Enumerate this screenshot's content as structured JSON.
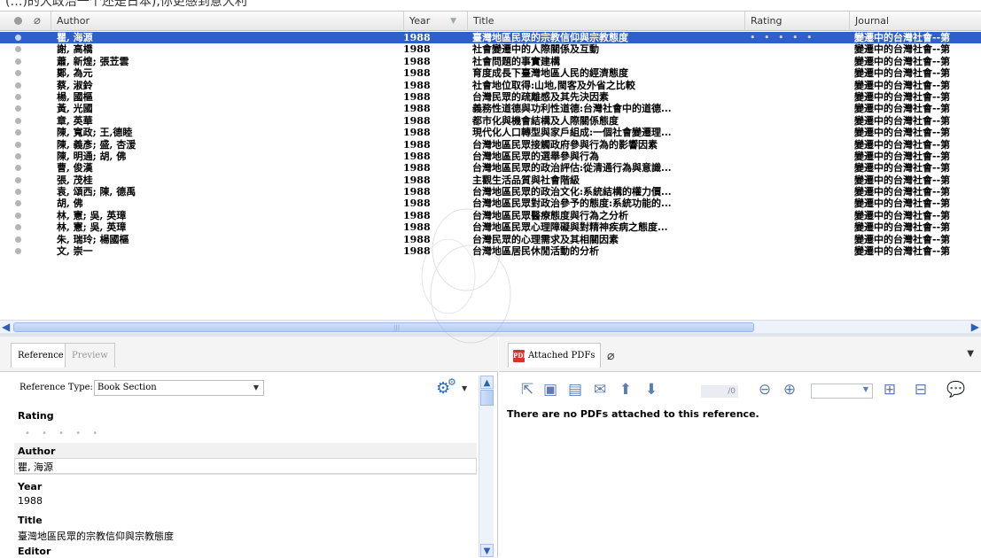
{
  "top_cut_text": "(…)的大政治一个还是日本),你更感到意大利",
  "list": {
    "columns": {
      "author": "Author",
      "year": "Year",
      "title": "Title",
      "rating": "Rating",
      "journal": "Journal"
    },
    "rows": [
      {
        "author": "瞿, 海源",
        "year": "1988",
        "title": "臺灣地區民眾的宗教信仰與宗教態度",
        "rating": "• • • • •",
        "journal": "變遷中的台灣社會--第"
      },
      {
        "author": "謝, 高橋",
        "year": "1988",
        "title": "社會變遷中的人際關係及互動",
        "rating": "",
        "journal": "變遷中的台灣社會--第"
      },
      {
        "author": "蕭, 新煌; 張苙雲",
        "year": "1988",
        "title": "社會問題的事實建構",
        "rating": "",
        "journal": "變遷中的台灣社會--第"
      },
      {
        "author": "鄭, 為元",
        "year": "1988",
        "title": "育度成長下臺灣地區人民的經濟態度",
        "rating": "",
        "journal": "變遷中的台灣社會--第"
      },
      {
        "author": "蔡, 淑鈴",
        "year": "1988",
        "title": "社會地位取得:山地,閩客及外省之比較",
        "rating": "",
        "journal": "變遷中的台灣社會--第"
      },
      {
        "author": "楊, 國樞",
        "year": "1988",
        "title": "台灣民眾的疏離感及其先決因素",
        "rating": "",
        "journal": "變遷中的台灣社會--第"
      },
      {
        "author": "黃, 光國",
        "year": "1988",
        "title": "義務性道德與功利性道德:台灣社會中的道德...",
        "rating": "",
        "journal": "變遷中的台灣社會--第"
      },
      {
        "author": "章, 英華",
        "year": "1988",
        "title": "都市化與機會結構及人際關係態度",
        "rating": "",
        "journal": "變遷中的台灣社會--第"
      },
      {
        "author": "陳, 寬政; 王,德睦",
        "year": "1988",
        "title": "現代化人口轉型與家戶組成:一個社會變遷理...",
        "rating": "",
        "journal": "變遷中的台灣社會--第"
      },
      {
        "author": "陳, 義彥; 盛, 杏湲",
        "year": "1988",
        "title": "台灣地區民眾接觸政府參與行為的影響因素",
        "rating": "",
        "journal": "變遷中的台灣社會--第"
      },
      {
        "author": "陳, 明通; 胡, 佛",
        "year": "1988",
        "title": "台灣地區民眾的選舉參與行為",
        "rating": "",
        "journal": "變遷中的台灣社會--第"
      },
      {
        "author": "曹, 俊漢",
        "year": "1988",
        "title": "台灣地區民眾的政治評估:從清通行為與意識...",
        "rating": "",
        "journal": "變遷中的台灣社會--第"
      },
      {
        "author": "張, 茂桂",
        "year": "1988",
        "title": "主觀生活品質與社會階級",
        "rating": "",
        "journal": "變遷中的台灣社會--第"
      },
      {
        "author": "袁, 頌西; 陳, 德禹",
        "year": "1988",
        "title": "台灣地區民眾的政治文化:系統結構的權力價...",
        "rating": "",
        "journal": "變遷中的台灣社會--第"
      },
      {
        "author": "胡, 佛",
        "year": "1988",
        "title": "台灣地區民眾對政治參予的態度:系統功能的...",
        "rating": "",
        "journal": "變遷中的台灣社會--第"
      },
      {
        "author": "林, 憲; 吳, 英璋",
        "year": "1988",
        "title": "台灣地區民眾醫療態度與行為之分析",
        "rating": "",
        "journal": "變遷中的台灣社會--第"
      },
      {
        "author": "林, 憲; 吳, 英璋",
        "year": "1988",
        "title": "台灣地區民眾心理障礙與對精神疾病之態度...",
        "rating": "",
        "journal": "變遷中的台灣社會--第"
      },
      {
        "author": "朱, 瑞玲; 楊國樞",
        "year": "1988",
        "title": "台灣民眾的心理需求及其相關因素",
        "rating": "",
        "journal": "變遷中的台灣社會--第"
      },
      {
        "author": "文, 崇一",
        "year": "1988",
        "title": "台灣地區居民休閒活動的分析",
        "rating": "",
        "journal": "變遷中的台灣社會--第"
      }
    ],
    "selected_index": 0,
    "selected_color": "#2f5fcb"
  },
  "reference_panel": {
    "tabs": {
      "reference": "Reference",
      "preview": "Preview"
    },
    "ref_type_label": "Reference Type:",
    "ref_type_value": "Book Section",
    "fields": {
      "rating_label": "Rating",
      "rating_value": "• • • • •",
      "author_label": "Author",
      "author_value": "瞿, 海源",
      "year_label": "Year",
      "year_value": "1988",
      "title_label": "Title",
      "title_value": "臺灣地區民眾的宗教信仰與宗教態度",
      "editor_label": "Editor"
    }
  },
  "pdf_panel": {
    "tab_label": "Attached PDFs",
    "page_total": "/0",
    "message": "There are no PDFs attached to this reference.",
    "icons": [
      "open-external-icon",
      "save-icon",
      "print-icon",
      "email-icon",
      "arrow-up-icon",
      "arrow-down-icon",
      "zoom-out-icon",
      "zoom-in-icon",
      "page-layout-icon",
      "page-layout-2-icon",
      "comment-icon"
    ]
  }
}
